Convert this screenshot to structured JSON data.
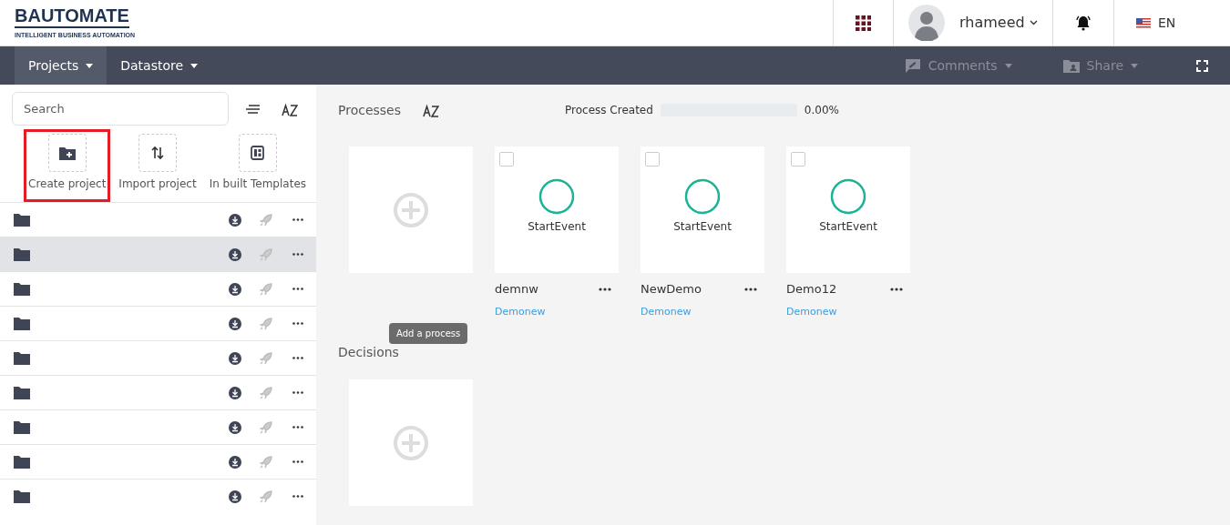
{
  "header": {
    "logo": {
      "title": "BAUTOMATE",
      "tagline": "INTELLIGENT BUSINESS AUTOMATION"
    },
    "user": "rhameed",
    "language": "EN"
  },
  "navbar": {
    "menus": [
      {
        "label": "Projects",
        "selected": true
      },
      {
        "label": "Datastore",
        "selected": false
      }
    ],
    "actions": [
      {
        "label": "Comments",
        "kind": "comments",
        "disabled": true
      },
      {
        "label": "Share",
        "kind": "share",
        "disabled": true
      }
    ]
  },
  "sidebar": {
    "search": {
      "placeholder": "Search"
    },
    "actions": [
      {
        "label": "Create project",
        "kind": "create",
        "highlighted": true
      },
      {
        "label": "Import project",
        "kind": "import",
        "highlighted": false
      },
      {
        "label": "In built Templates",
        "kind": "templates",
        "highlighted": false
      }
    ],
    "projects": [
      {
        "selected": false
      },
      {
        "selected": true
      },
      {
        "selected": false
      },
      {
        "selected": false
      },
      {
        "selected": false
      },
      {
        "selected": false
      },
      {
        "selected": false
      },
      {
        "selected": false
      },
      {
        "selected": false
      }
    ]
  },
  "processes": {
    "title": "Processes",
    "progress": {
      "label": "Process Created",
      "level": 0,
      "reading": "0.00%"
    },
    "add_tooltip": "Add a process",
    "cards": [
      {
        "name": "demnw",
        "project": "Demonew",
        "event": "StartEvent",
        "checked": false
      },
      {
        "name": "NewDemo",
        "project": "Demonew",
        "event": "StartEvent",
        "checked": false
      },
      {
        "name": "Demo12",
        "project": "Demonew",
        "event": "StartEvent",
        "checked": false
      }
    ]
  },
  "decisions": {
    "title": "Decisions"
  }
}
